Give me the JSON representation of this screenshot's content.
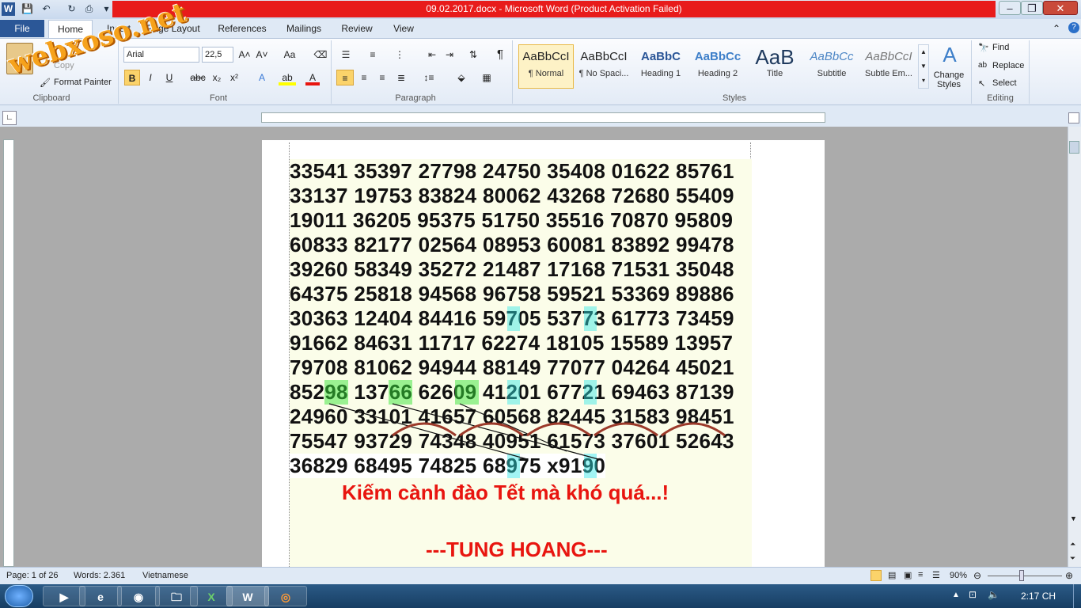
{
  "window": {
    "title": "09.02.2017.docx  -  Microsoft Word (Product Activation Failed)"
  },
  "watermark": "webxoso.net",
  "tabs": [
    "File",
    "Home",
    "Insert",
    "Page Layout",
    "References",
    "Mailings",
    "Review",
    "View"
  ],
  "clipboard": {
    "copy": "Copy",
    "format_painter": "Format Painter",
    "label": "Clipboard"
  },
  "font": {
    "family": "Arial",
    "size": "22,5",
    "label": "Font"
  },
  "paragraph": {
    "label": "Paragraph",
    "pilcrow": "¶"
  },
  "styles": {
    "items": [
      {
        "preview": "AaBbCcI",
        "name": "¶ Normal"
      },
      {
        "preview": "AaBbCcI",
        "name": "¶ No Spaci..."
      },
      {
        "preview": "AaBbC",
        "name": "Heading 1"
      },
      {
        "preview": "AaBbCc",
        "name": "Heading 2"
      },
      {
        "preview": "AaB",
        "name": "Title"
      },
      {
        "preview": "AaBbCc",
        "name": "Subtitle"
      },
      {
        "preview": "AaBbCcI",
        "name": "Subtle Em..."
      }
    ],
    "change": "Change Styles",
    "label": "Styles"
  },
  "editing": {
    "find": "Find",
    "replace": "Replace",
    "select": "Select",
    "label": "Editing"
  },
  "document": {
    "rows": [
      "33541 35397 27798 24750 35408 01622 85761",
      "33137 19753 83824 80062 43268 72680 55409",
      "19011 36205 95375 51750 35516 70870 95809",
      "60833 82177 02564 08953 60081 83892 99478",
      "39260 58349 35272 21487 17168 71531 35048",
      "64375 25818 94568 96758 59521 53369 89886",
      "30363 12404 84416 59705 53773 61773 73459",
      "91662 84631 11717 62274 18105 15589 13957",
      "79708 81062 94944 88149 77077 04264 45021",
      "85298 13766 62609 41201 67721 69463 87139",
      "24960 33101 41657 60568 82445 31583 98451",
      "75547 93729 74348 40951 61573 37601 52643"
    ],
    "result_line": "36829 68495 74825 68975 x9190",
    "caption": "Kiếm cành đào Tết mà khó quá...!",
    "signature": "---TUNG HOANG---"
  },
  "status": {
    "page": "Page: 1 of 26",
    "words": "Words: 2.361",
    "language": "Vietnamese",
    "zoom": "90%"
  },
  "taskbar": {
    "time": "2:17 CH"
  }
}
